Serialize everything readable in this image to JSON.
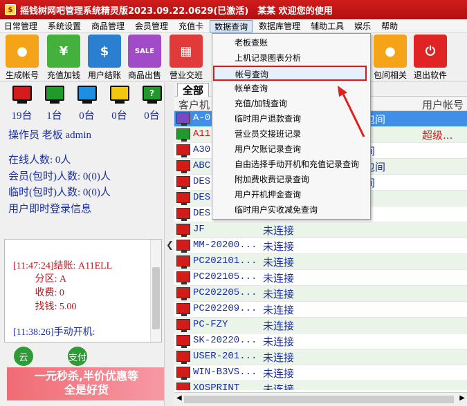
{
  "window": {
    "title": "摇钱树网吧管理系统精灵版2023.09.22.0629(已激活)　某某 欢迎您的使用"
  },
  "menu": [
    "日常管理",
    "系统设置",
    "商品管理",
    "会员管理",
    "充值卡",
    "数据查询",
    "数据库管理",
    "辅助工具",
    "娱乐",
    "帮助"
  ],
  "active_menu_index": 5,
  "toolbar": {
    "items": [
      {
        "label": "生成帐号",
        "icon": "user-icon",
        "color": "#f5a41a"
      },
      {
        "label": "充值加钱",
        "icon": "money-bag-icon",
        "color": "#44b13d"
      },
      {
        "label": "用户结账",
        "icon": "dollar-icon",
        "color": "#2a7fd0"
      },
      {
        "label": "商品出售",
        "icon": "sale-tag-icon",
        "color": "#a24bc9"
      },
      {
        "label": "营业交班",
        "icon": "shift-card-icon",
        "color": "#e03a3a"
      },
      {
        "label": "包间相关",
        "icon": "user-icon",
        "color": "#f5a41a"
      },
      {
        "label": "退出软件",
        "icon": "power-icon",
        "color": "#e02424"
      }
    ]
  },
  "status_monitors": [
    {
      "count": "19台",
      "color": "#d51a1a",
      "symbol": ""
    },
    {
      "count": "1台",
      "color": "#1f9a2b",
      "symbol": ""
    },
    {
      "count": "0台",
      "color": "#1e8fe0",
      "symbol": ""
    },
    {
      "count": "0台",
      "color": "#f2c80f",
      "symbol": ""
    },
    {
      "count": "0台",
      "color": "#1f9a2b",
      "symbol": "?"
    }
  ],
  "left": {
    "operator": "操作员 老板 admin",
    "online": "在线人数: 0人",
    "member": "会员(包时)人数: 0(0)人",
    "temp": "临时(包时)人数: 0(0)人",
    "login_info": "用户即时登录信息"
  },
  "log": {
    "lines": [
      "[11:47:24]结账: A11ELL",
      "         分区: A",
      "         收费: 0",
      "         找钱: 5.00",
      "[11:38:26]手动开机:"
    ]
  },
  "bottom_icons": [
    "云",
    "支付"
  ],
  "banner": {
    "line1": "一元秒杀,半价优惠等",
    "line2": "全是好货"
  },
  "tab": "全部",
  "grid": {
    "headers": [
      "客户机",
      "区",
      "用户帐号"
    ],
    "rows": [
      {
        "name": "A-0",
        "status": "",
        "c3": "号包间",
        "c4": "",
        "pc": "purple",
        "style": "sel"
      },
      {
        "name": "A11",
        "status": "",
        "c3": "",
        "c4": "超级...",
        "pc": "green",
        "style": "red"
      },
      {
        "name": "A30",
        "status": "",
        "c3": "包间",
        "c4": "",
        "pc": "red",
        "style": ""
      },
      {
        "name": "ABC",
        "status": "",
        "c3": "号包间",
        "c4": "",
        "pc": "red",
        "style": ""
      },
      {
        "name": "DES",
        "status": "",
        "c3": "包间",
        "c4": "",
        "pc": "red",
        "style": ""
      },
      {
        "name": "DES",
        "status": "",
        "c3": "",
        "c4": "",
        "pc": "red",
        "style": ""
      },
      {
        "name": "DES",
        "status": "",
        "c3": "",
        "c4": "",
        "pc": "red",
        "style": ""
      },
      {
        "name": "JF",
        "status": "未连接",
        "c3": "",
        "c4": "",
        "pc": "red",
        "style": ""
      },
      {
        "name": "MM-20200...",
        "status": "未连接",
        "c3": "",
        "c4": "",
        "pc": "red",
        "style": ""
      },
      {
        "name": "PC202101...",
        "status": "未连接",
        "c3": "",
        "c4": "",
        "pc": "red",
        "style": ""
      },
      {
        "name": "PC202105...",
        "status": "未连接",
        "c3": "",
        "c4": "",
        "pc": "red",
        "style": ""
      },
      {
        "name": "PC202205...",
        "status": "未连接",
        "c3": "",
        "c4": "",
        "pc": "red",
        "style": ""
      },
      {
        "name": "PC202209...",
        "status": "未连接",
        "c3": "",
        "c4": "",
        "pc": "red",
        "style": ""
      },
      {
        "name": "PC-FZY",
        "status": "未连接",
        "c3": "",
        "c4": "",
        "pc": "red",
        "style": ""
      },
      {
        "name": "SK-20220...",
        "status": "未连接",
        "c3": "",
        "c4": "",
        "pc": "red",
        "style": ""
      },
      {
        "name": "USER-201...",
        "status": "未连接",
        "c3": "",
        "c4": "",
        "pc": "red",
        "style": ""
      },
      {
        "name": "WIN-B3VS...",
        "status": "未连接",
        "c3": "",
        "c4": "",
        "pc": "red",
        "style": ""
      },
      {
        "name": "XOSPRINT",
        "status": "未连接",
        "c3": "",
        "c4": "",
        "pc": "red",
        "style": ""
      }
    ]
  },
  "dropdown": {
    "items": [
      "老板查账",
      "上机记录图表分析",
      "帐号查询",
      "帐单查询",
      "充值/加钱查询",
      "临时用户退款查询",
      "营业员交接班记录",
      "用户欠账记录查询",
      "自由选择手动开机和充值记录查询",
      "附加费收费记录查询",
      "用户开机押金查询",
      "临时用户实收减免查询"
    ],
    "highlight_index": 2
  }
}
